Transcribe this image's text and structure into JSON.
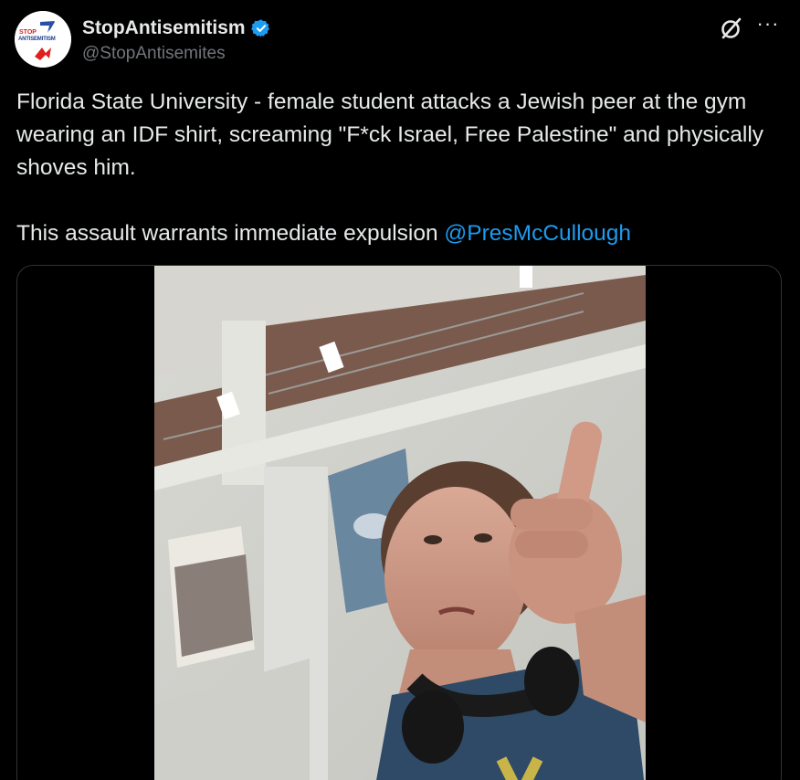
{
  "author": {
    "display_name": "StopAntisemitism",
    "handle": "@StopAntisemites",
    "avatar_text_top": "STOP",
    "avatar_text_mid": "ANTISEMITISM",
    "verified_color": "#1d9bf0"
  },
  "actions": {
    "grok_icon": "grok-icon",
    "more_label": "···"
  },
  "tweet": {
    "text_line1": "Florida State University - female student attacks a Jewish peer at the gym wearing an IDF shirt, screaming \"F*ck Israel, Free Palestine\" and physically shoves him.",
    "text_line2_prefix": "This assault warrants immediate expulsion ",
    "mention": "@PresMcCullough"
  },
  "colors": {
    "background": "#000000",
    "text": "#e7e9ea",
    "muted": "#71767b",
    "link": "#1d9bf0",
    "border": "#2f3336"
  }
}
